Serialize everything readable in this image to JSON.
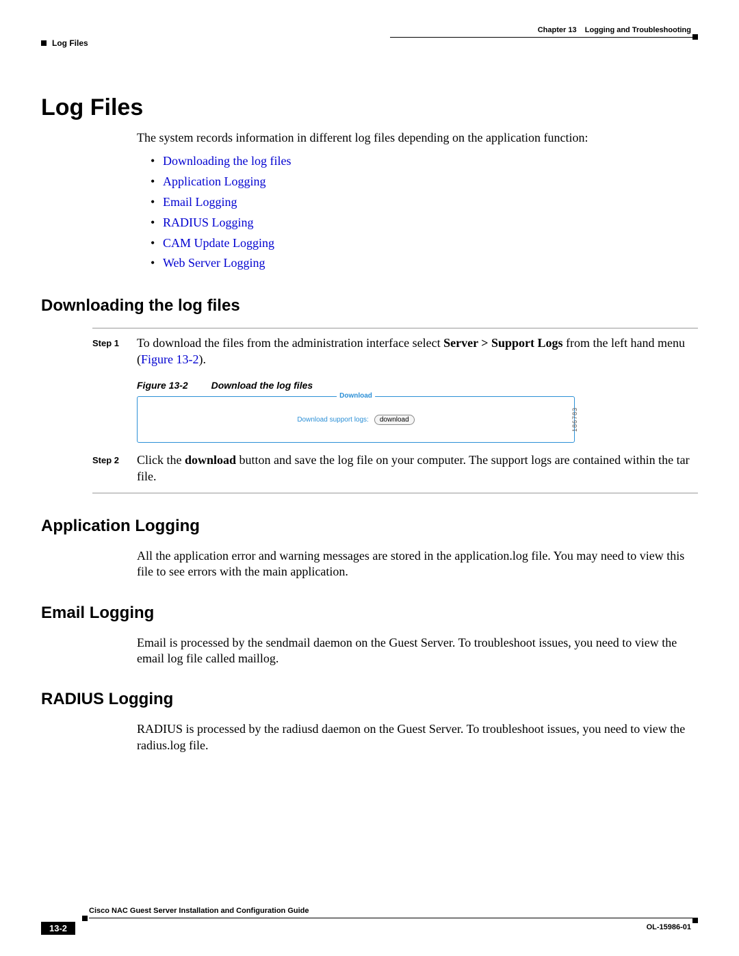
{
  "header": {
    "chapter": "Chapter 13",
    "chapter_title": "Logging and Troubleshooting",
    "section": "Log Files"
  },
  "h1": "Log Files",
  "intro": "The system records information in different log files depending on the application function:",
  "links": [
    "Downloading the log files",
    "Application Logging",
    "Email Logging",
    "RADIUS Logging",
    "CAM Update Logging",
    "Web Server Logging"
  ],
  "sections": {
    "downloading": {
      "title": "Downloading the log files",
      "step1": {
        "label": "Step 1",
        "pre": "To download the files from the administration interface select ",
        "bold": "Server > Support Logs",
        "mid": " from the left hand menu (",
        "ref": "Figure 13-2",
        "post": ")."
      },
      "figure": {
        "num": "Figure 13-2",
        "title": "Download the log files",
        "legend": "Download",
        "label": "Download support logs:",
        "button": "download",
        "id": "186783"
      },
      "step2": {
        "label": "Step 2",
        "pre": "Click the ",
        "bold": "download",
        "post": " button and save the log file on your computer. The support logs are contained within the tar file."
      }
    },
    "app": {
      "title": "Application Logging",
      "body": "All the application error and warning messages are stored in the application.log file. You may need to view this file to see errors with the main application."
    },
    "email": {
      "title": "Email Logging",
      "body": "Email is processed by the sendmail daemon on the Guest Server. To troubleshoot issues, you need to view the email log file called maillog."
    },
    "radius": {
      "title": "RADIUS Logging",
      "body": "RADIUS is processed by the radiusd daemon on the Guest Server. To troubleshoot issues, you need to view the radius.log file."
    }
  },
  "footer": {
    "guide": "Cisco NAC Guest Server Installation and Configuration Guide",
    "page": "13-2",
    "code": "OL-15986-01"
  }
}
